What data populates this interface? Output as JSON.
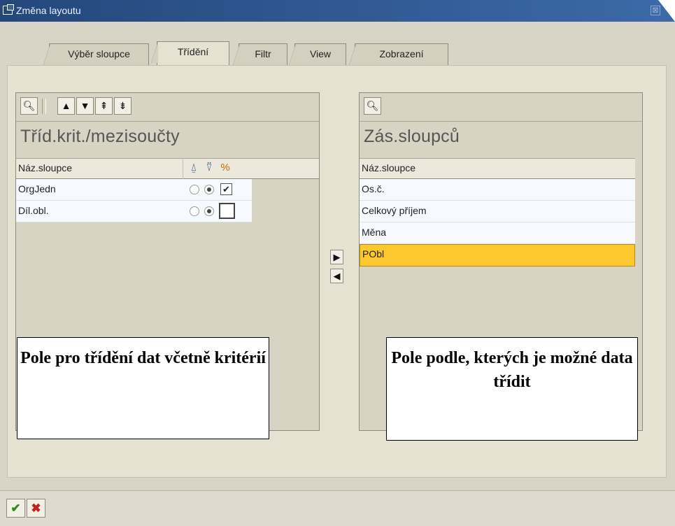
{
  "window": {
    "title": "Změna layoutu"
  },
  "tabs": [
    {
      "label": "Výběr sloupce",
      "active": false
    },
    {
      "label": "Třídění",
      "active": true
    },
    {
      "label": "Filtr",
      "active": false
    },
    {
      "label": "View",
      "active": false
    },
    {
      "label": "Zobrazení",
      "active": false
    }
  ],
  "left_panel": {
    "toolbar_icons": [
      "binoculars-find-icon",
      "move-up-icon",
      "move-down-icon",
      "move-top-icon",
      "move-bottom-icon"
    ],
    "heading": "Tříd.krit./mezisoučty",
    "column_header": "Náz.sloupce",
    "column_icons": [
      "ascending-sort-icon",
      "descending-sort-icon",
      "subtotal-icon"
    ],
    "rows": [
      {
        "name": "OrgJedn",
        "ascending": false,
        "descending": true,
        "subtotal": true
      },
      {
        "name": "Díl.obl.",
        "ascending": false,
        "descending": true,
        "subtotal": false
      }
    ]
  },
  "right_panel": {
    "toolbar_icons": [
      "binoculars-find-icon"
    ],
    "heading": "Zás.sloupců",
    "column_header": "Náz.sloupce",
    "rows": [
      {
        "name": "Os.č.",
        "selected": false
      },
      {
        "name": "Celkový příjem",
        "selected": false
      },
      {
        "name": "Měna",
        "selected": false
      },
      {
        "name": "PObl",
        "selected": true
      }
    ]
  },
  "move_buttons": {
    "right": "▶",
    "left": "◀"
  },
  "callouts": {
    "left": "Pole pro třídění dat včetně kritérií",
    "right": "Pole podle, kterých je možné data třídit"
  },
  "footer": {
    "confirm_icon": "checkmark-icon",
    "cancel_icon": "cancel-x-icon"
  },
  "colors": {
    "title_bar": "#24477c",
    "selected_row": "#fdc72e",
    "confirm": "#2e8b1f",
    "cancel": "#c8201a"
  }
}
